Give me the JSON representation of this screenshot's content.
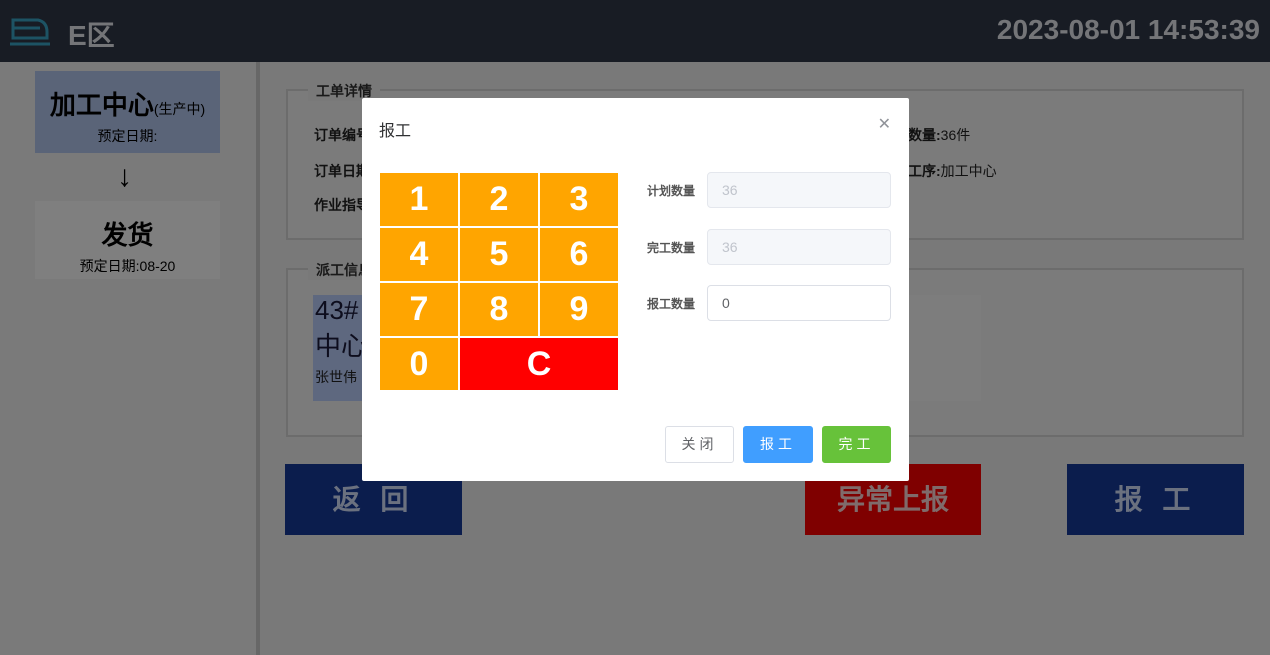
{
  "header": {
    "zone": "E区",
    "datetime": "2023-08-01 14:53:39",
    "logo_icon": "train-icon"
  },
  "flow": {
    "steps": [
      {
        "title": "加工中心",
        "tag": "(生产中)",
        "date_label": "预定日期:",
        "date": "",
        "color": "#b5c8f0"
      },
      {
        "title": "发货",
        "tag": "",
        "date_label": "预定日期:",
        "date": "08-20",
        "color": "#ffffff"
      }
    ],
    "arrow": "↓"
  },
  "detail": {
    "legend": "工单详情",
    "order_no_label": "订单编号",
    "order_date_label": "订单日期",
    "instruction_label": "作业指导",
    "qty_label": "数量:",
    "qty_value": "36件",
    "process_label": "工序:",
    "process_value": "加工中心"
  },
  "dispatch": {
    "legend": "派工信息",
    "card_line1": "43#",
    "card_line2": "中心",
    "card_name": "张世伟"
  },
  "actions": {
    "back": "返 回",
    "abnormal": "异常上报",
    "report": "报 工"
  },
  "dialog": {
    "title": "报工",
    "close_icon": "close-icon",
    "keys": [
      "1",
      "2",
      "3",
      "4",
      "5",
      "6",
      "7",
      "8",
      "9",
      "0",
      "C"
    ],
    "fields": {
      "planned": {
        "label": "计划数量",
        "value": "36"
      },
      "completed": {
        "label": "完工数量",
        "value": "36"
      },
      "report": {
        "label": "报工数量",
        "value": "0"
      }
    },
    "buttons": {
      "close": "关闭",
      "report": "报工",
      "done": "完工"
    }
  },
  "colors": {
    "keypad": "#ffa500",
    "clear": "#ff0000",
    "primary": "#409eff",
    "success": "#67c23a",
    "navy": "#173a9b"
  }
}
